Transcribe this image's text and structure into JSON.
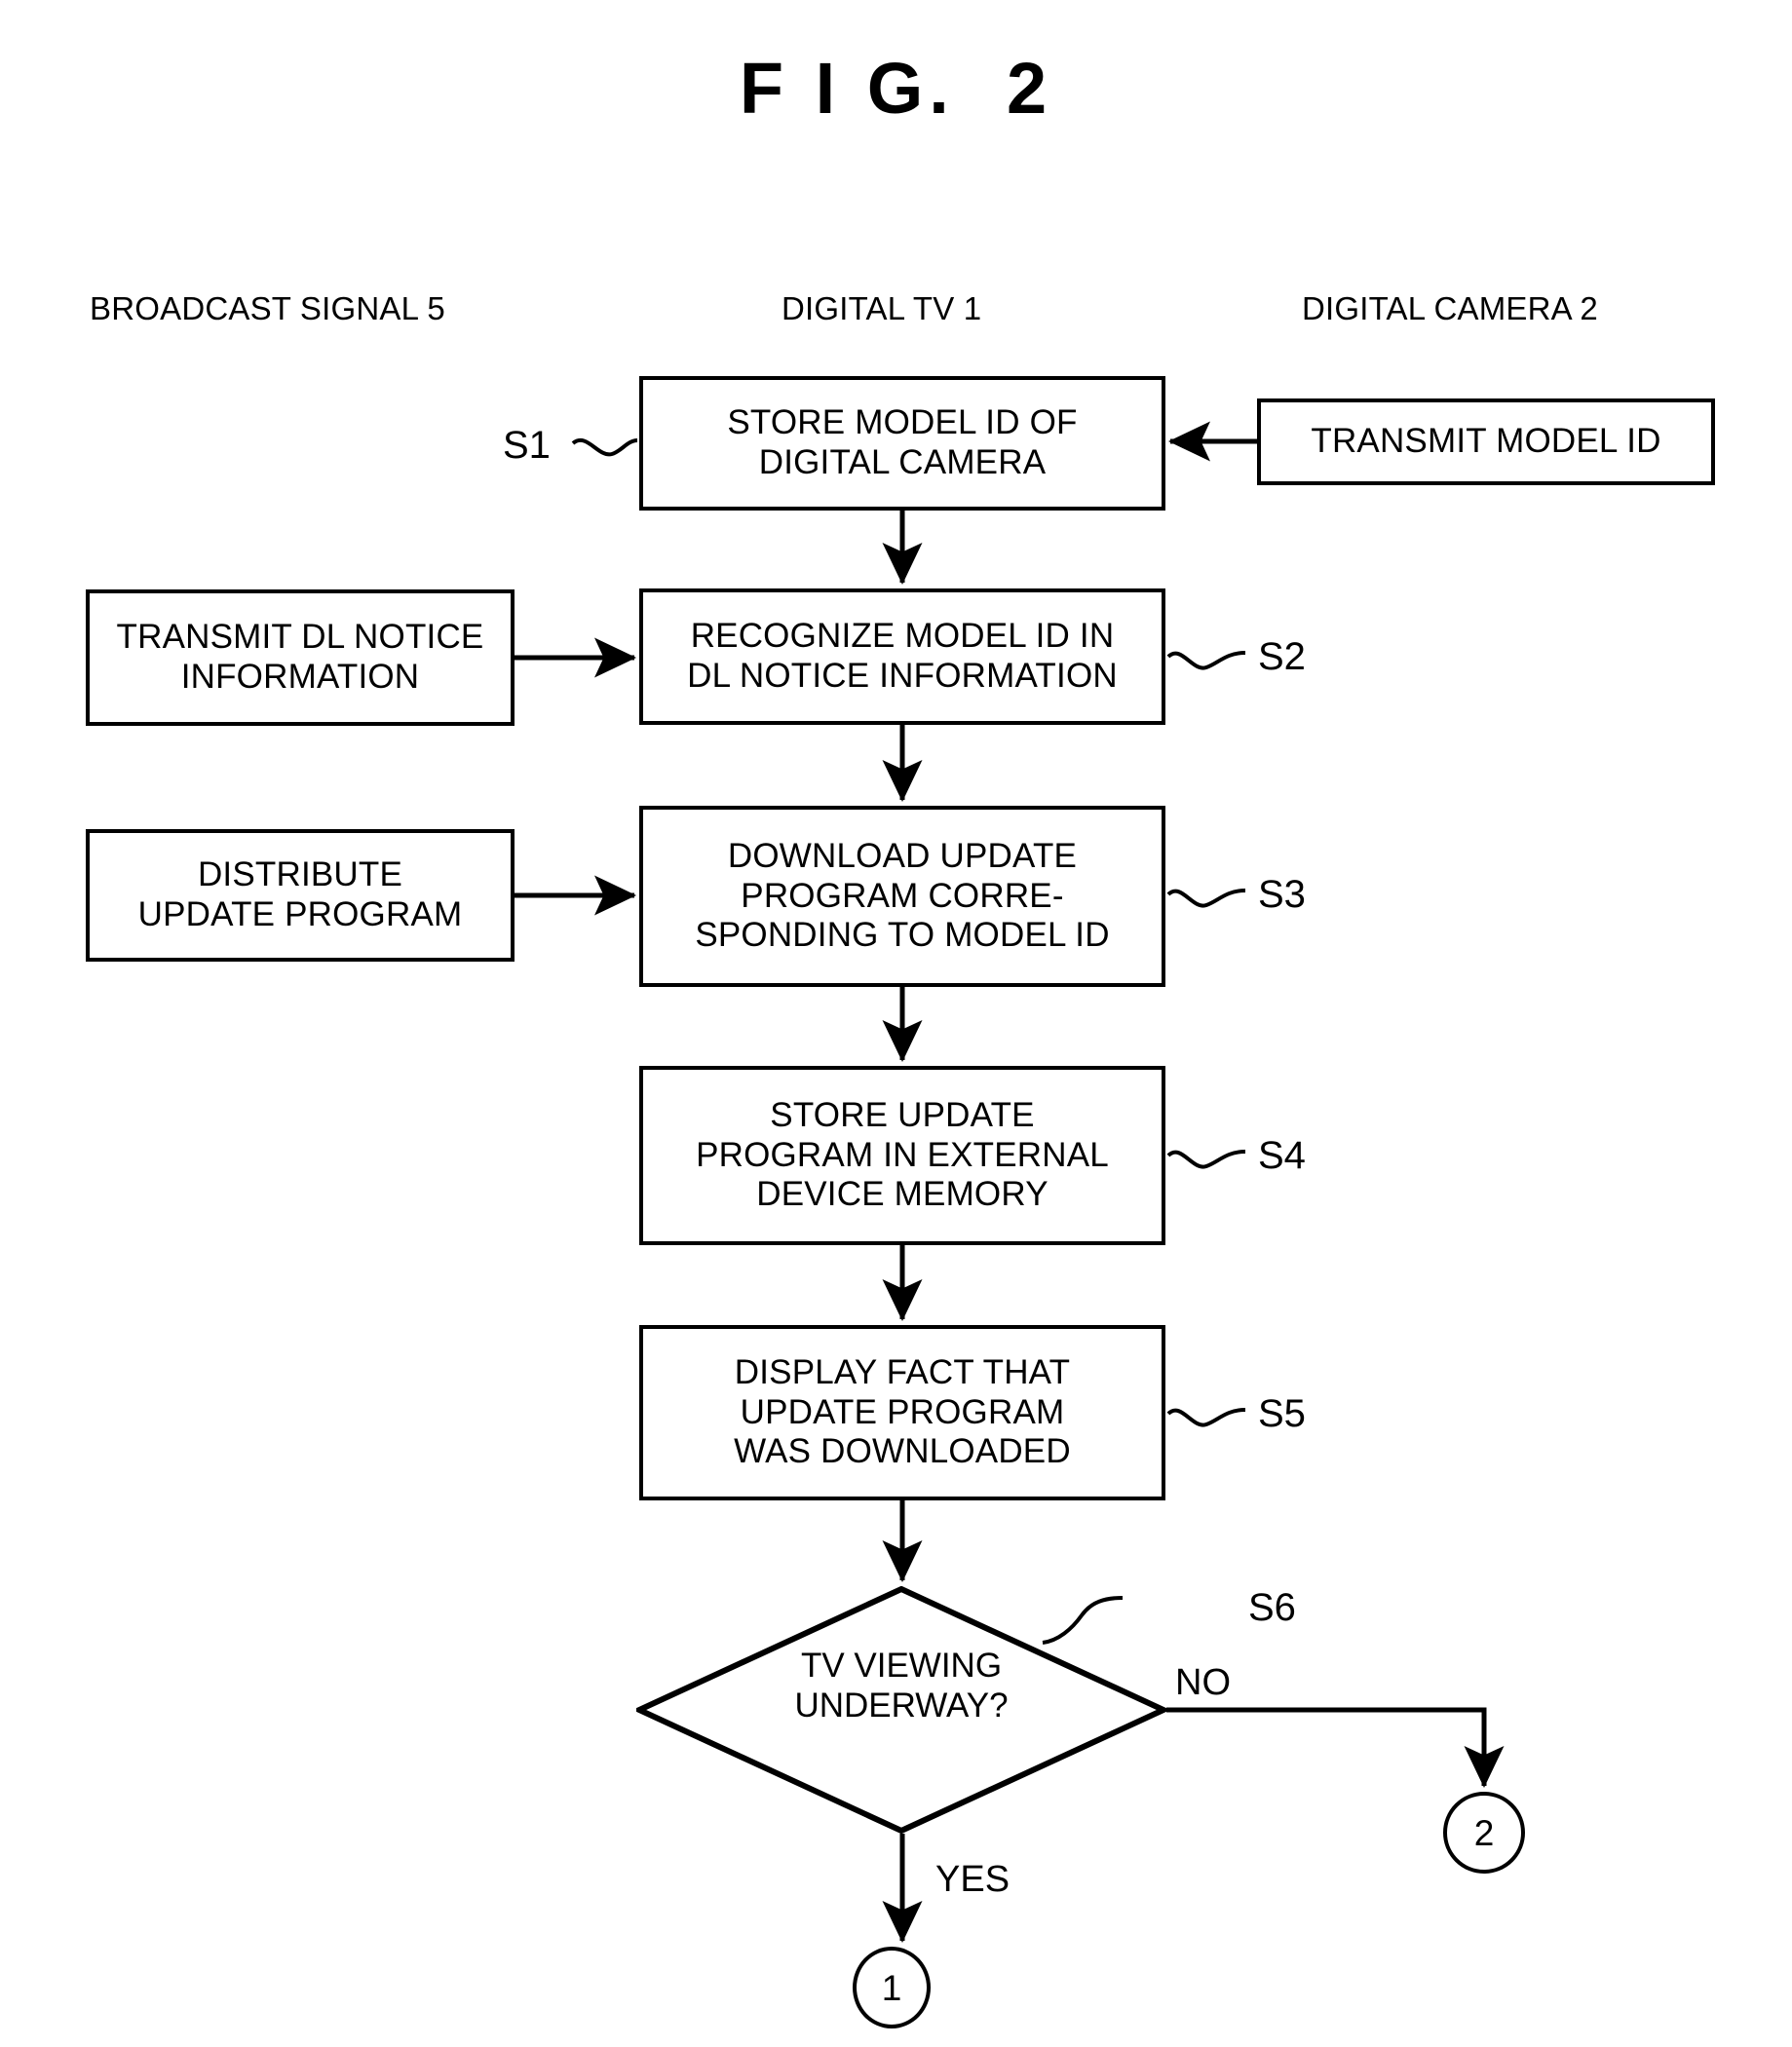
{
  "figure": {
    "title": "F I G.  2"
  },
  "columns": [
    {
      "id": "broadcast",
      "label": "BROADCAST SIGNAL 5"
    },
    {
      "id": "digital_tv",
      "label": "DIGITAL TV 1"
    },
    {
      "id": "digital_camera",
      "label": "DIGITAL CAMERA 2"
    }
  ],
  "nodes": {
    "s1": {
      "step": "S1",
      "text": "STORE MODEL ID OF\nDIGITAL CAMERA",
      "shape": "process",
      "column": "digital_tv"
    },
    "camera_transmit": {
      "text": "TRANSMIT MODEL ID",
      "shape": "process",
      "column": "digital_camera"
    },
    "s2": {
      "step": "S2",
      "text": "RECOGNIZE MODEL ID IN\nDL NOTICE INFORMATION",
      "shape": "process",
      "column": "digital_tv"
    },
    "dl_notice": {
      "text": "TRANSMIT DL NOTICE\nINFORMATION",
      "shape": "process",
      "column": "broadcast"
    },
    "s3": {
      "step": "S3",
      "text": "DOWNLOAD UPDATE\nPROGRAM CORRE-\nSPONDING TO MODEL ID",
      "shape": "process",
      "column": "digital_tv"
    },
    "distribute": {
      "text": "DISTRIBUTE\nUPDATE PROGRAM",
      "shape": "process",
      "column": "broadcast"
    },
    "s4": {
      "step": "S4",
      "text": "STORE UPDATE\nPROGRAM IN EXTERNAL\nDEVICE MEMORY",
      "shape": "process",
      "column": "digital_tv"
    },
    "s5": {
      "step": "S5",
      "text": "DISPLAY FACT THAT\nUPDATE PROGRAM\nWAS DOWNLOADED",
      "shape": "process",
      "column": "digital_tv"
    },
    "s6": {
      "step": "S6",
      "text": "TV VIEWING\nUNDERWAY?",
      "shape": "decision",
      "column": "digital_tv"
    }
  },
  "branches": {
    "no": "NO",
    "yes": "YES"
  },
  "connectors": [
    {
      "id": "conn_1",
      "label": "1",
      "from_branch": "YES"
    },
    {
      "id": "conn_2",
      "label": "2",
      "from_branch": "NO"
    }
  ],
  "style": {
    "stroke": "#000000",
    "background": "#ffffff"
  }
}
